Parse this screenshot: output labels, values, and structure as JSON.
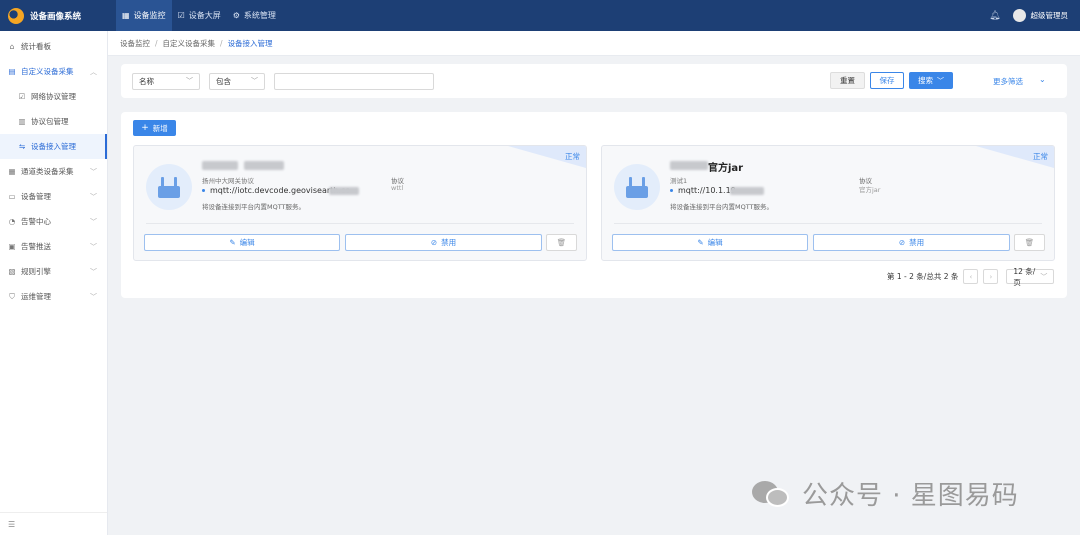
{
  "header": {
    "app_title": "设备画像系统",
    "nav": [
      {
        "label": "设备监控",
        "icon": "monitor-grid-icon",
        "active": true
      },
      {
        "label": "设备大屏",
        "icon": "screen-icon",
        "active": false
      },
      {
        "label": "系统管理",
        "icon": "settings-icon",
        "active": false
      }
    ],
    "user": "超级管理员"
  },
  "sidebar": {
    "items": [
      {
        "label": "统计看板",
        "icon": "home-icon"
      },
      {
        "label": "自定义设备采集",
        "icon": "chart-box-icon",
        "open": true
      },
      {
        "label": "网络协议管理",
        "icon": "checkbox-icon",
        "sub": true
      },
      {
        "label": "协议包管理",
        "icon": "bar-chart-icon",
        "sub": true
      },
      {
        "label": "设备接入管理",
        "icon": "link-icon",
        "sub": true,
        "active": true
      },
      {
        "label": "通道类设备采集",
        "icon": "grid-icon"
      },
      {
        "label": "设备管理",
        "icon": "device-icon"
      },
      {
        "label": "告警中心",
        "icon": "alarm-icon"
      },
      {
        "label": "告警推送",
        "icon": "push-icon"
      },
      {
        "label": "规则引擎",
        "icon": "rule-icon"
      },
      {
        "label": "运维管理",
        "icon": "shield-icon"
      }
    ]
  },
  "breadcrumb": [
    "设备监控",
    "自定义设备采集",
    "设备接入管理"
  ],
  "filter": {
    "field": "名称",
    "operator": "包含",
    "value": "",
    "reset": "重置",
    "save": "保存",
    "search": "搜索",
    "more": "更多筛选"
  },
  "actions": {
    "add": "新增"
  },
  "cards": [
    {
      "status": "正常",
      "name_tail": "",
      "subtitle": "扬州中大网关协议",
      "url": "mqtt://iotc.devcode.geovisearth.co",
      "desc": "将设备连接到平台内置MQTT服务。",
      "protocol_label": "协议",
      "protocol_value": "wttl",
      "edit": "编辑",
      "disable": "禁用"
    },
    {
      "status": "正常",
      "name_tail": "官方jar",
      "subtitle": "测试1",
      "url": "mqtt://10.1.19",
      "desc": "将设备连接到平台内置MQTT服务。",
      "protocol_label": "协议",
      "protocol_value": "官方jar",
      "edit": "编辑",
      "disable": "禁用"
    }
  ],
  "pagination": {
    "summary": "第 1 - 2 条/总共 2 条",
    "page_size": "12 条/页"
  },
  "watermark": "公众号 · 星图易码",
  "colors": {
    "header_bg": "#1d3f75",
    "primary": "#3a86e8"
  }
}
